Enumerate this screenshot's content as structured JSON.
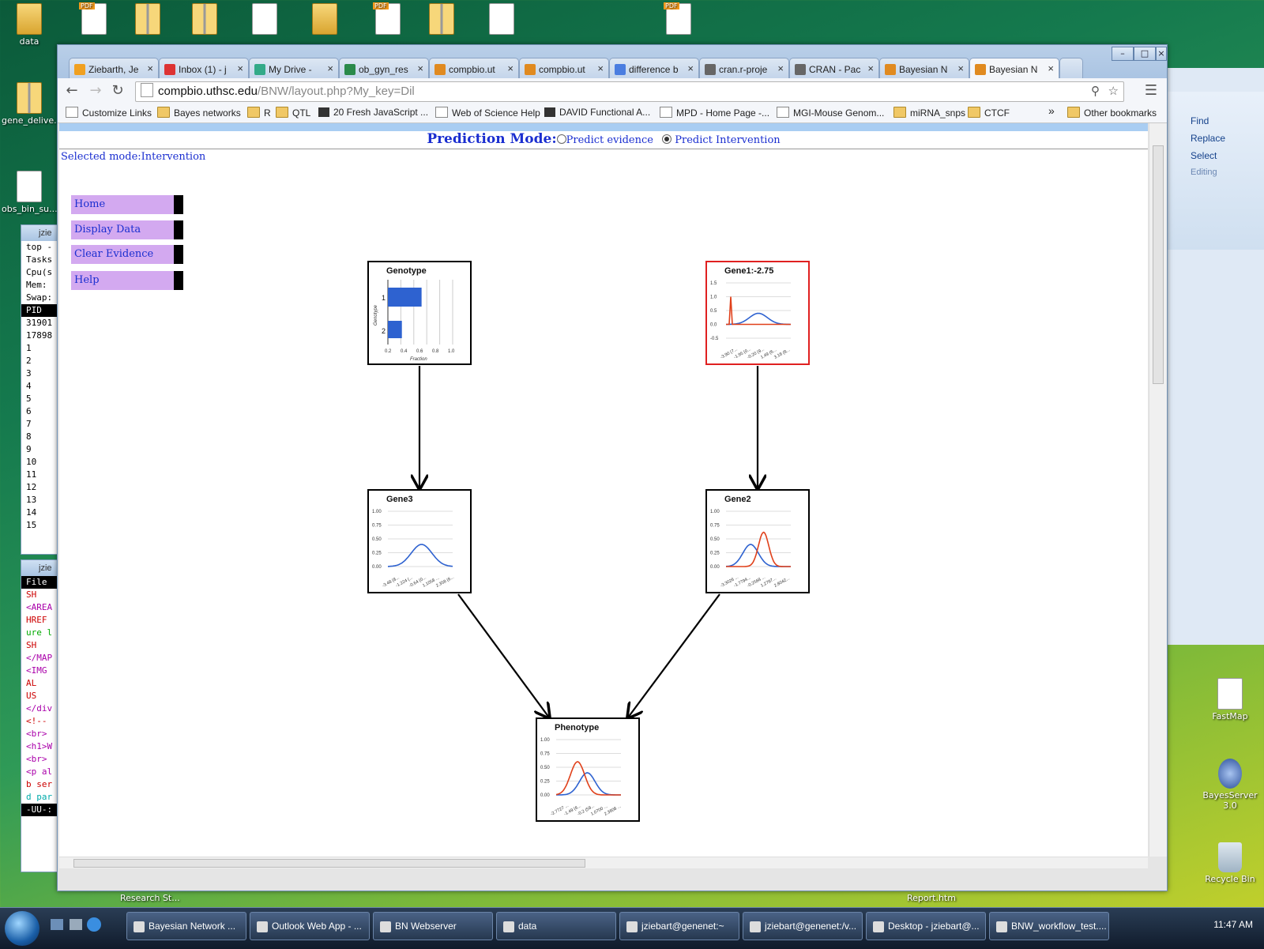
{
  "desktop": {
    "top_icons": [
      {
        "label": "data",
        "type": "folder"
      },
      {
        "label": "",
        "type": "pdf"
      },
      {
        "label": "",
        "type": "zip"
      },
      {
        "label": "",
        "type": "zip"
      },
      {
        "label": "",
        "type": "doc"
      },
      {
        "label": "",
        "type": "folder"
      },
      {
        "label": "",
        "type": "pdf"
      },
      {
        "label": "",
        "type": "zip"
      },
      {
        "label": "",
        "type": "doc"
      },
      {
        "label": "",
        "type": "pdf"
      }
    ],
    "left_icons": [
      {
        "label": "gene_delive..."
      },
      {
        "label": "obs_bin_su..."
      }
    ],
    "right_icons": [
      {
        "label": "FastMap"
      },
      {
        "label": "BayesServer 3.0"
      },
      {
        "label": "Recycle Bin"
      }
    ],
    "bottom_labels": [
      "Research St...",
      "Report.htm"
    ]
  },
  "terminal1": {
    "title": "jzie",
    "lines": [
      "top -",
      "Tasks",
      "Cpu(s",
      "Mem:",
      "Swap:",
      "",
      "  PID",
      "31901",
      "17898",
      "    1",
      "    2",
      "    3",
      "    4",
      "    5",
      "    6",
      "    7",
      "    8",
      "    9",
      "   10",
      "   11",
      "   12",
      "   13",
      "   14",
      "   15"
    ]
  },
  "terminal2": {
    "title": "jzie",
    "lines": [
      {
        "t": "File",
        "c": "#fff",
        "bg": "#000"
      },
      {
        "t": "   SH",
        "c": "#c00"
      },
      {
        "t": "",
        "c": "#000"
      },
      {
        "t": "<AREA",
        "c": "#a0a"
      },
      {
        "t": " HREF",
        "c": "#c00"
      },
      {
        "t": "ure l",
        "c": "#0a0"
      },
      {
        "t": "   SH",
        "c": "#c00"
      },
      {
        "t": "",
        "c": "#000"
      },
      {
        "t": "</MAP",
        "c": "#a0a"
      },
      {
        "t": "",
        "c": "#000"
      },
      {
        "t": "<IMG",
        "c": "#a0a"
      },
      {
        "t": "   AL",
        "c": "#c00"
      },
      {
        "t": "   US",
        "c": "#c00"
      },
      {
        "t": "</div",
        "c": "#a0a"
      },
      {
        "t": "",
        "c": "#000"
      },
      {
        "t": "<!--",
        "c": "#c00"
      },
      {
        "t": "<br>",
        "c": "#a0a"
      },
      {
        "t": "<h1>W",
        "c": "#a0a"
      },
      {
        "t": "<br>",
        "c": "#a0a"
      },
      {
        "t": "<p al",
        "c": "#a0a"
      },
      {
        "t": "b ser",
        "c": "#c00"
      },
      {
        "t": "d par",
        "c": "#0aa"
      },
      {
        "t": "-UU-:",
        "c": "#fff",
        "bg": "#000"
      }
    ]
  },
  "word": {
    "items": [
      "Find",
      "Replace",
      "Select",
      "Editing"
    ]
  },
  "browser": {
    "tabs": [
      {
        "label": "Ziebarth, Je",
        "color": "#f0a020",
        "active": false
      },
      {
        "label": "Inbox (1) - j",
        "color": "#d33",
        "active": false
      },
      {
        "label": "My Drive - ",
        "color": "#3a8",
        "active": false
      },
      {
        "label": "ob_gyn_res",
        "color": "#2a8a4a",
        "active": false
      },
      {
        "label": "compbio.ut",
        "color": "#e08a20",
        "active": false
      },
      {
        "label": "compbio.ut",
        "color": "#e08a20",
        "active": false
      },
      {
        "label": "difference b",
        "color": "#4a7de0",
        "active": false
      },
      {
        "label": "cran.r-proje",
        "color": "#666",
        "active": false
      },
      {
        "label": "CRAN - Pac",
        "color": "#666",
        "active": false
      },
      {
        "label": "Bayesian N",
        "color": "#e08a20",
        "active": false
      },
      {
        "label": "Bayesian N",
        "color": "#e08a20",
        "active": true
      }
    ],
    "tab_close": "×",
    "url_host": "compbio.uthsc.edu",
    "url_path": "/BNW/layout.php?My_key=Dil",
    "bookmarks": [
      {
        "label": "Customize Links",
        "icon": "p"
      },
      {
        "label": "Bayes networks",
        "icon": "f"
      },
      {
        "label": "R",
        "icon": "f"
      },
      {
        "label": "QTL",
        "icon": "f"
      },
      {
        "label": "20 Fresh JavaScript ...",
        "icon": "k"
      },
      {
        "label": "Web of Science Help",
        "icon": "p"
      },
      {
        "label": "DAVID Functional A...",
        "icon": "k"
      },
      {
        "label": "MPD - Home Page -...",
        "icon": "p"
      },
      {
        "label": "MGI-Mouse Genom...",
        "icon": "p"
      },
      {
        "label": "miRNA_snps",
        "icon": "f"
      },
      {
        "label": "CTCF",
        "icon": "f"
      }
    ],
    "bookmarks_more": "»",
    "other_bookmarks": "Other bookmarks"
  },
  "page": {
    "prediction_label": "Prediction Mode:",
    "option_evidence": "Predict evidence",
    "option_intervention": "Predict Intervention",
    "selected_mode": "Selected mode:Intervention",
    "menu": [
      "Home",
      "Display Data",
      "Clear Evidence",
      "Help"
    ]
  },
  "network": {
    "series_colors": {
      "blue": "#2e62d0",
      "red": "#e0401a"
    },
    "nodes": [
      {
        "id": "genotype",
        "title": "Genotype",
        "chart": {
          "type": "bar",
          "orientation": "horizontal",
          "categories": [
            "1",
            "2"
          ],
          "values": [
            0.65,
            0.27
          ],
          "xlabel": "Fraction",
          "ylabel": "Genotype",
          "xticks": [
            "0.2",
            "0.4",
            "0.6",
            "0.8",
            "1.0"
          ]
        }
      },
      {
        "id": "gene1",
        "title": "Gene1:-2.75",
        "evidence": true,
        "chart": {
          "type": "line",
          "yticks": [
            "1.5",
            "1.0",
            "0.5",
            "0.0",
            "-0.5"
          ],
          "xticks": [
            "-3.90 (7...",
            "-1.95 (0...",
            "-0.20 (9...",
            "1.49 (6...",
            "3.18 (8..."
          ]
        }
      },
      {
        "id": "gene3",
        "title": "Gene3",
        "chart": {
          "type": "line",
          "yticks": [
            "1.00",
            "0.75",
            "0.50",
            "0.25",
            "0.00"
          ],
          "xticks": [
            "-3.48 (8...",
            "-1.224 (...",
            "-0.64 (0...",
            "1.1058 ...",
            "2.358 (6..."
          ]
        }
      },
      {
        "id": "gene2",
        "title": "Gene2",
        "chart": {
          "type": "line",
          "yticks": [
            "1.00",
            "0.75",
            "0.50",
            "0.25",
            "0.00"
          ],
          "xticks": [
            "-3.3026 ...",
            "-1.7794...",
            "-0.2568 ...",
            "1.2787...",
            "2.8042..."
          ]
        }
      },
      {
        "id": "phenotype",
        "title": "Phenotype",
        "chart": {
          "type": "line",
          "yticks": [
            "1.00",
            "0.75",
            "0.50",
            "0.25",
            "0.00"
          ],
          "xticks": [
            "-2.7727 ...",
            "-1.49 (6...",
            "-0.2 (59...",
            "1.0700 ...",
            "2.3608 ..."
          ]
        }
      }
    ]
  },
  "taskbar": {
    "buttons": [
      {
        "label": "Bayesian Network ..."
      },
      {
        "label": "Outlook Web App - ..."
      },
      {
        "label": "BN Webserver"
      },
      {
        "label": "data"
      },
      {
        "label": "jziebart@genenet:~"
      },
      {
        "label": "jziebart@genenet:/v..."
      },
      {
        "label": "Desktop - jziebart@..."
      },
      {
        "label": "BNW_workflow_test...."
      }
    ],
    "clock": "11:47 AM"
  }
}
